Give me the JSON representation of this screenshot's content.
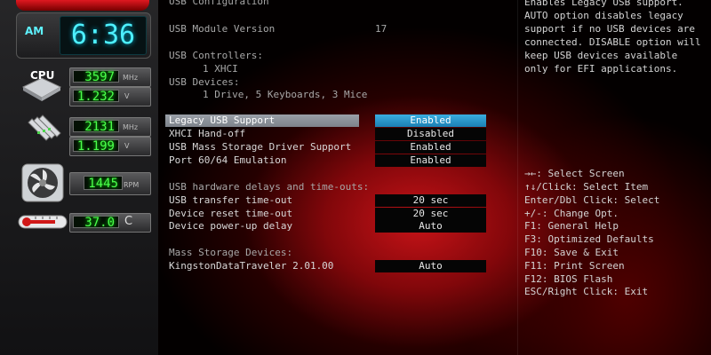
{
  "hw_monitor": {
    "ampm": "AM",
    "time": "6:36",
    "cpu_label": "CPU",
    "cpu_freq": "3597",
    "cpu_freq_unit": "MHz",
    "cpu_volt": "1.232",
    "cpu_volt_unit": "V",
    "mem_freq": "2131",
    "mem_freq_unit": "MHz",
    "mem_volt": "1.199",
    "mem_volt_unit": "V",
    "fan_rpm": "1445",
    "fan_unit": "RPM",
    "temp": "37.0",
    "temp_unit": "C"
  },
  "info": {
    "usb_config": "USB Configuration",
    "module_version_label": "USB Module Version",
    "module_version_value": "17",
    "controllers_label": "USB Controllers:",
    "controllers_value": "1 XHCI",
    "devices_label": "USB Devices:",
    "devices_value": "1 Drive, 5 Keyboards, 3 Mice",
    "delays_header": "USB hardware delays and time-outs:",
    "mass_storage_header": "Mass Storage Devices:"
  },
  "settings": [
    {
      "label": "Legacy USB Support",
      "value": "Enabled",
      "selected": true
    },
    {
      "label": "XHCI Hand-off",
      "value": "Disabled"
    },
    {
      "label": "USB Mass Storage Driver Support",
      "value": "Enabled"
    },
    {
      "label": "Port 60/64 Emulation",
      "value": "Enabled"
    },
    {
      "label": "USB transfer time-out",
      "value": "20 sec"
    },
    {
      "label": "Device reset time-out",
      "value": "20 sec"
    },
    {
      "label": "Device power-up delay",
      "value": "Auto"
    },
    {
      "label": "KingstonDataTraveler 2.01.00",
      "value": "Auto"
    }
  ],
  "help_text": "Enables Legacy USB support.\nAUTO option disables legacy\nsupport if no USB devices are\nconnected. DISABLE option will\nkeep USB devices available\nonly for EFI applications.",
  "key_help": [
    "→←: Select Screen",
    "↑↓/Click: Select Item",
    "Enter/Dbl Click: Select",
    "+/-: Change Opt.",
    "F1: General Help",
    "F3: Optimized Defaults",
    "F10: Save & Exit",
    "F11: Print Screen",
    "F12: BIOS Flash",
    "ESC/Right Click: Exit"
  ]
}
